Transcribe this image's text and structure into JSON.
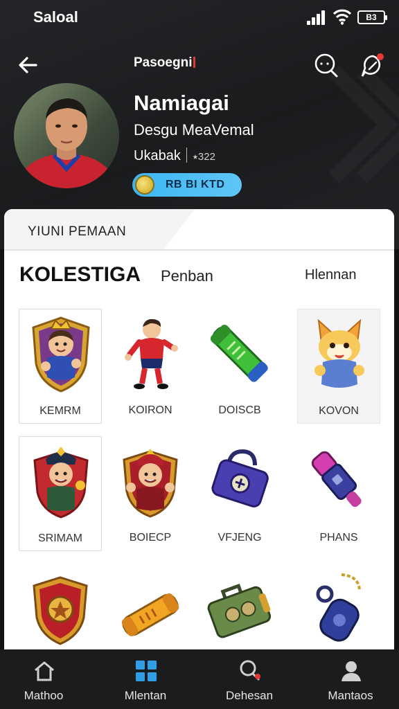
{
  "status_bar": {
    "carrier": "Saloal",
    "battery": "B3"
  },
  "nav": {
    "title": "Pasoegni"
  },
  "profile": {
    "name": "Namiagai",
    "subtitle": "Desgu MeaVemal",
    "meta_left": "Ukabak",
    "meta_rating": "⭑322",
    "badge": "RB BI KTD"
  },
  "panel": {
    "header": "YIUNI PEMAAN",
    "tabs": [
      {
        "label": "KOLESTIGA"
      },
      {
        "label": "Penban"
      },
      {
        "label": "Hlennan"
      }
    ]
  },
  "grid": [
    {
      "label": "KEMRM",
      "icon": "shield-hero-icon"
    },
    {
      "label": "KOIRON",
      "icon": "soccer-player-icon"
    },
    {
      "label": "DOISCB",
      "icon": "green-tube-icon"
    },
    {
      "label": "KOVON",
      "icon": "fox-mascot-icon"
    },
    {
      "label": "SRIMAM",
      "icon": "police-hero-icon"
    },
    {
      "label": "BOIECP",
      "icon": "red-hero-icon"
    },
    {
      "label": "VFJENG",
      "icon": "purple-bag-icon"
    },
    {
      "label": "PHANS",
      "icon": "purple-flashlight-icon"
    },
    {
      "label": "",
      "icon": "red-shield-icon"
    },
    {
      "label": "",
      "icon": "gold-tube-icon"
    },
    {
      "label": "",
      "icon": "green-case-icon"
    },
    {
      "label": "",
      "icon": "blue-keychain-icon"
    }
  ],
  "bottom_nav": [
    {
      "label": "Mathoo",
      "icon": "home-icon"
    },
    {
      "label": "Mlentan",
      "icon": "grid-icon"
    },
    {
      "label": "Dehesan",
      "icon": "search-people-icon"
    },
    {
      "label": "Mantaos",
      "icon": "person-icon"
    }
  ],
  "colors": {
    "accent": "#3db6f2",
    "header_bg": "#1f2022",
    "notify": "#e53935"
  }
}
